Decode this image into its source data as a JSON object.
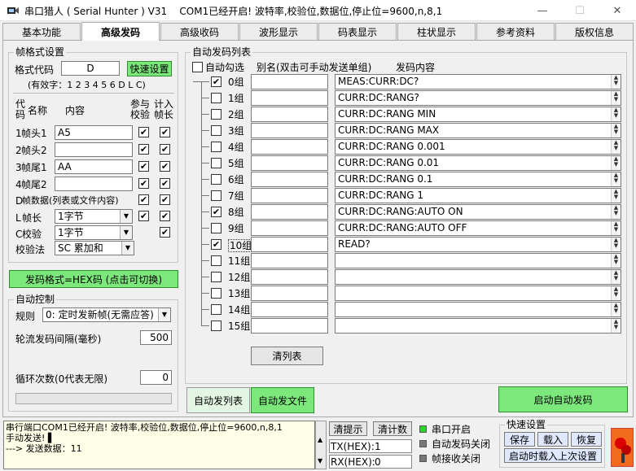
{
  "window": {
    "app_title": "串口猎人 ( Serial Hunter ) V31",
    "status_title": "COM1已经开启!  波特率,校验位,数据位,停止位=9600,n,8,1",
    "min": "—",
    "max": "☐",
    "close": "✕"
  },
  "tabs": [
    "基本功能",
    "高级发码",
    "高级收码",
    "波形显示",
    "码表显示",
    "柱状显示",
    "参考资料",
    "版权信息"
  ],
  "frame": {
    "legend": "帧格式设置",
    "format_label": "格式代码",
    "format_value": "D",
    "quick_btn": "快速设置",
    "valid_chars": "(有效字：1 2 3 4 5 6 D L C)",
    "hdr_code": "代\n码",
    "hdr_name": "名称",
    "hdr_content": "内容",
    "hdr_check": "参与\n校验",
    "hdr_len": "计入\n帧长",
    "rows": [
      {
        "code": "1",
        "name": "帧头1",
        "value": "A5",
        "check": "✔",
        "len": "✔"
      },
      {
        "code": "2",
        "name": "帧头2",
        "value": "",
        "check": "✔",
        "len": "✔"
      },
      {
        "code": "3",
        "name": "帧尾1",
        "value": "AA",
        "check": "✔",
        "len": "✔"
      },
      {
        "code": "4",
        "name": "帧尾2",
        "value": "",
        "check": "✔",
        "len": "✔"
      }
    ],
    "data_row": {
      "code": "D",
      "name": "帧数据(列表或文件内容)",
      "check": "✔",
      "len": "✔"
    },
    "l_row": {
      "code": "L",
      "name": "帧长",
      "value": "1字节",
      "check": "✔",
      "len": "✔"
    },
    "c_row": {
      "code": "C",
      "name": "校验",
      "value": "1字节",
      "len": "✔"
    },
    "method_label": "校验法",
    "method_value": "SC 累加和"
  },
  "hex_btn": "发码格式=HEX码 (点击可切换)",
  "auto": {
    "legend": "自动控制",
    "rule_label": "规则",
    "rule_value": "0: 定时发新帧(无需应答)",
    "interval_label": "轮流发码间隔(毫秒)",
    "interval_value": "500",
    "loop_label": "循环次数(0代表无限)",
    "loop_value": "0"
  },
  "list": {
    "legend": "自动发码列表",
    "auto_check_label": "自动勾选",
    "alias_header": "别名(双击可手动发送单组)",
    "content_header": "发码内容",
    "rows": [
      {
        "label": "0组",
        "checked": "✔",
        "content": "MEAS:CURR:DC?"
      },
      {
        "label": "1组",
        "checked": "",
        "content": "CURR:DC:RANG?"
      },
      {
        "label": "2组",
        "checked": "",
        "content": "CURR:DC:RANG MIN"
      },
      {
        "label": "3组",
        "checked": "",
        "content": "CURR:DC:RANG MAX"
      },
      {
        "label": "4组",
        "checked": "",
        "content": "CURR:DC:RANG 0.001"
      },
      {
        "label": "5组",
        "checked": "",
        "content": "CURR:DC:RANG 0.01"
      },
      {
        "label": "6组",
        "checked": "",
        "content": "CURR:DC:RANG 0.1"
      },
      {
        "label": "7组",
        "checked": "",
        "content": "CURR:DC:RANG 1"
      },
      {
        "label": "8组",
        "checked": "✔",
        "content": "CURR:DC:RANG:AUTO ON"
      },
      {
        "label": "9组",
        "checked": "",
        "content": "CURR:DC:RANG:AUTO OFF"
      },
      {
        "label": "10组",
        "checked": "✔",
        "content": "READ?"
      },
      {
        "label": "11组",
        "checked": "",
        "content": ""
      },
      {
        "label": "12组",
        "checked": "",
        "content": ""
      },
      {
        "label": "13组",
        "checked": "",
        "content": ""
      },
      {
        "label": "14组",
        "checked": "",
        "content": ""
      },
      {
        "label": "15组",
        "checked": "",
        "content": ""
      }
    ],
    "clear_btn": "清列表"
  },
  "lower": {
    "tab_list": "自动发列表",
    "tab_file": "自动发文件",
    "start_btn": "启动自动发码"
  },
  "status": {
    "log_lines": [
      "串行端口COM1已经开启!  波特率,校验位,数据位,停止位=9600,n,8,1",
      "手动发送! ▌",
      "---> 发送数据：11"
    ],
    "clear_hint": "清提示",
    "clear_count": "清计数",
    "tx_label": "TX(HEX):",
    "tx_value": "1",
    "rx_label": "RX(HEX):",
    "rx_value": "0",
    "port_open": "串口开启",
    "auto_off": "自动发码关闭",
    "frame_recv_off": "帧接收关闭",
    "quick_legend": "快速设置",
    "save": "保存",
    "load": "载入",
    "restore": "恢复",
    "load_last": "启动时载入上次设置"
  },
  "colors": {
    "accent_green": "#7ce87c",
    "led_green": "#2fd12f",
    "log_bg": "#ffffe8",
    "selected_tab": "#ffffff"
  }
}
